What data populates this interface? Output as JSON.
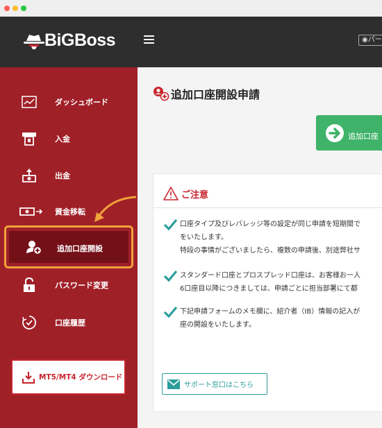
{
  "window": {
    "controls": [
      "close",
      "minimize",
      "maximize"
    ]
  },
  "header": {
    "brand": "BiGBoss",
    "menu_icon": "hamburger-icon",
    "preview_label": "パー"
  },
  "sidebar": {
    "items": [
      {
        "label": "ダッシュボード",
        "icon": "dashboard-chart-icon"
      },
      {
        "label": "入金",
        "icon": "atm-deposit-icon"
      },
      {
        "label": "出金",
        "icon": "withdraw-cash-icon"
      },
      {
        "label": "資金移転",
        "icon": "transfer-icon"
      },
      {
        "label": "追加口座開設",
        "icon": "add-account-icon",
        "active": true
      },
      {
        "label": "パスワード変更",
        "icon": "lock-icon"
      },
      {
        "label": "口座履歴",
        "icon": "history-icon"
      }
    ],
    "download_label": "MT5/MT4 ダウンロード"
  },
  "main": {
    "title": "追加口座開設申請",
    "add_button_label": "追加口座",
    "notice": {
      "heading": "ご注意",
      "items": [
        {
          "lines": [
            "口座タイプ及びレバレッジ等の設定が同じ申請を短期間で",
            "をいたします。",
            "特段の事情がございましたら、複数の申請後、別途弊社サ"
          ]
        },
        {
          "lines": [
            "スタンダード口座とプロスプレッド口座は、お客様お一人",
            "6口座目以降につきましては、申請ごとに担当部署にて都"
          ]
        },
        {
          "lines": [
            "下記申請フォームのメモ欄に、紹介者（IB）情報の記入が",
            "座の開設をいたします。"
          ]
        }
      ]
    },
    "support_label": "サポート窓口はこちら"
  },
  "colors": {
    "sidebar": "#a02028",
    "active_item": "#741018",
    "highlight": "#f0a23b",
    "primary_green": "#40b36a",
    "check_teal": "#2a9d9a",
    "danger": "#c8262e"
  }
}
